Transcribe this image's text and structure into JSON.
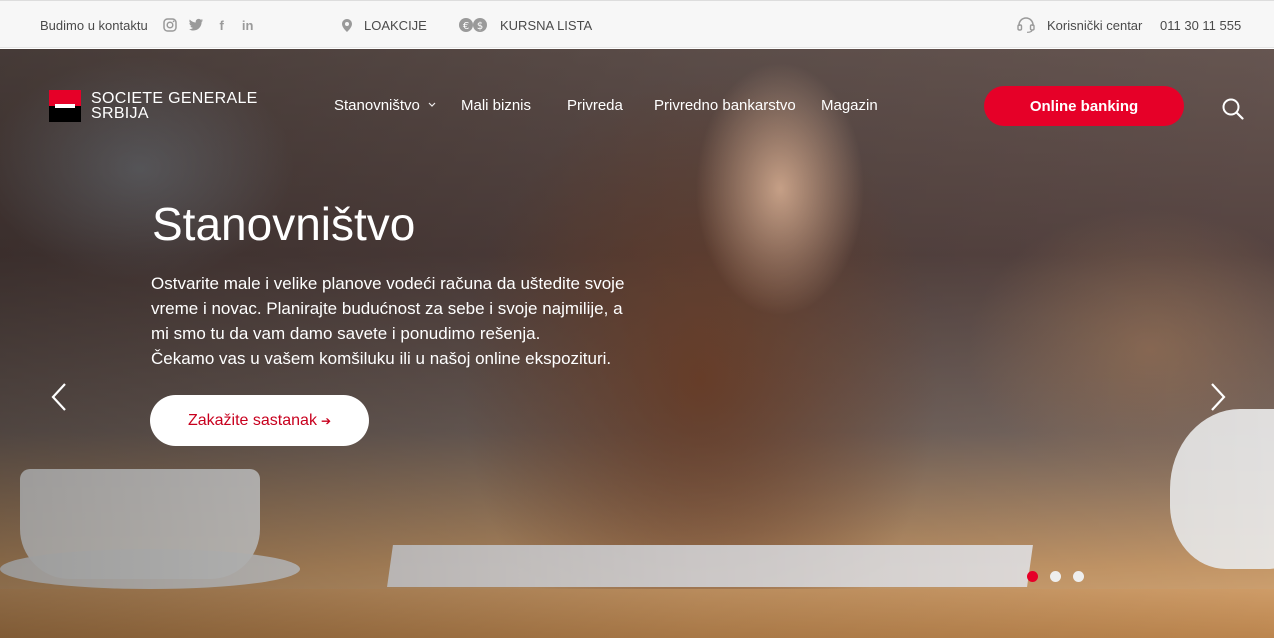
{
  "topbar": {
    "contact_label": "Budimo u kontaktu",
    "social": [
      {
        "icon": "instagram-icon"
      },
      {
        "icon": "twitter-icon"
      },
      {
        "icon": "facebook-icon",
        "glyph": "f"
      },
      {
        "icon": "linkedin-icon",
        "glyph": "in"
      }
    ],
    "locations_label": "LOAKCIJE",
    "rates_label": "KURSNA LISTA",
    "rates_icon_glyphs": [
      "€",
      "$"
    ],
    "user_center_label": "Korisnički centar",
    "phone": "011 30 11 555"
  },
  "header": {
    "logo_line1": "SOCIETE GENERALE",
    "logo_line2": "SRBIJA",
    "nav": [
      {
        "label": "Stanovništvo",
        "has_dropdown": true
      },
      {
        "label": "Mali biznis"
      },
      {
        "label": "Privreda"
      },
      {
        "label": "Privredno bankarstvo"
      },
      {
        "label": "Magazin"
      }
    ],
    "online_banking_label": "Online banking"
  },
  "hero": {
    "title": "Stanovništvo",
    "text_lines": [
      "Ostvarite male i velike planove vodeći računa da uštedite svoje",
      "vreme i novac. Planirajte budućnost za sebe i svoje najmilije, a",
      "mi smo tu da vam damo savete i ponudimo rešenja.",
      "Čekamo vas u vašem komšiluku ili u našoj online ekspozituri."
    ],
    "cta_label": "Zakažite sastanak",
    "cta_arrow": "➔",
    "slides_total": 3,
    "active_slide": 1
  },
  "colors": {
    "brand_red": "#e60028",
    "cta_text": "#c8001e"
  }
}
